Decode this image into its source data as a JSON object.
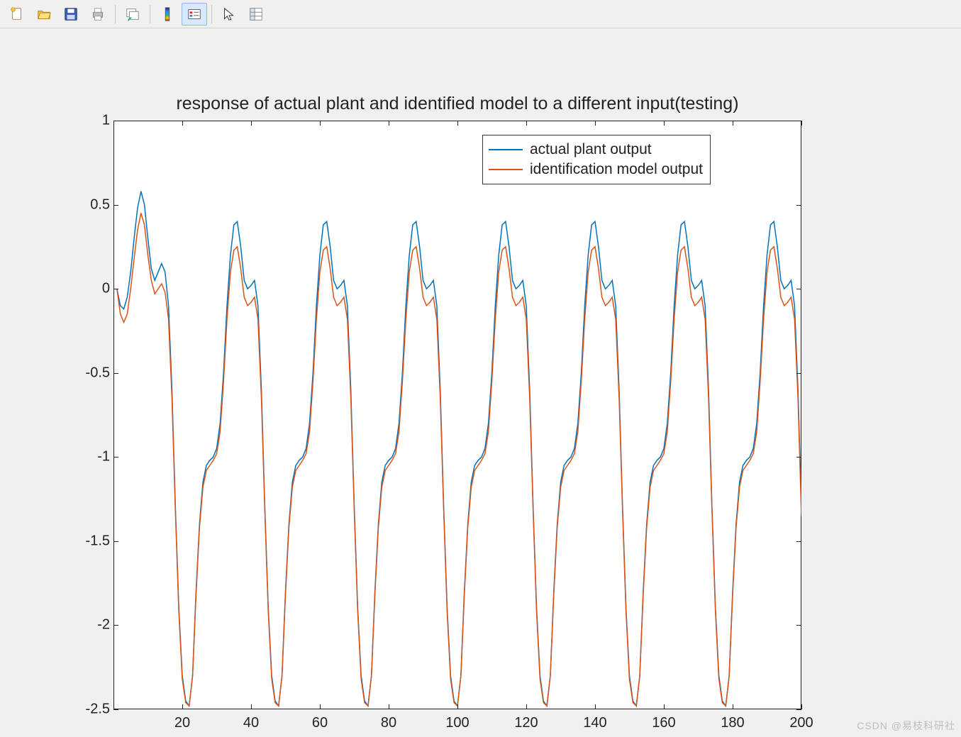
{
  "toolbar": {
    "items": [
      {
        "name": "new-icon",
        "sep": false,
        "active": false
      },
      {
        "name": "open-icon",
        "sep": false,
        "active": false
      },
      {
        "name": "save-icon",
        "sep": false,
        "active": false
      },
      {
        "name": "print-icon",
        "sep": false,
        "active": false
      },
      {
        "name": "sep"
      },
      {
        "name": "link-axes-icon",
        "sep": false,
        "active": false
      },
      {
        "name": "sep"
      },
      {
        "name": "colorbar-icon",
        "sep": false,
        "active": false
      },
      {
        "name": "legend-icon",
        "sep": false,
        "active": true
      },
      {
        "name": "sep"
      },
      {
        "name": "cursor-icon",
        "sep": false,
        "active": false
      },
      {
        "name": "properties-icon",
        "sep": false,
        "active": false
      }
    ]
  },
  "watermark": "CSDN @易枝科研社",
  "chart_data": {
    "type": "line",
    "title": "response of actual plant and identified model to a different input(testing)",
    "xlabel": "",
    "ylabel": "",
    "xlim": [
      0,
      200
    ],
    "ylim": [
      -2.5,
      1
    ],
    "xticks": [
      20,
      40,
      60,
      80,
      100,
      120,
      140,
      160,
      180,
      200
    ],
    "yticks": [
      -2.5,
      -2,
      -1.5,
      -1,
      -0.5,
      0,
      0.5,
      1
    ],
    "legend_position": "northeast",
    "series": [
      {
        "name": "actual plant output",
        "color": "#0072bd",
        "x": [
          1,
          2,
          3,
          4,
          5,
          6,
          7,
          8,
          9,
          10,
          11,
          12,
          13,
          14,
          15,
          16,
          17,
          18,
          19,
          20,
          21,
          22,
          23,
          24,
          25,
          26,
          27,
          28,
          29,
          30,
          31,
          32,
          33,
          34,
          35,
          36,
          37,
          38,
          39,
          40,
          41,
          42,
          43,
          44,
          45,
          46,
          47,
          48,
          49,
          50,
          51,
          52,
          53,
          54,
          55,
          56,
          57,
          58,
          59,
          60,
          61,
          62,
          63,
          64,
          65,
          66,
          67,
          68,
          69,
          70,
          71,
          72,
          73,
          74,
          75,
          76,
          77,
          78,
          79,
          80,
          81,
          82,
          83,
          84,
          85,
          86,
          87,
          88,
          89,
          90,
          91,
          92,
          93,
          94,
          95,
          96,
          97,
          98,
          99,
          100,
          101,
          102,
          103,
          104,
          105,
          106,
          107,
          108,
          109,
          110,
          111,
          112,
          113,
          114,
          115,
          116,
          117,
          118,
          119,
          120,
          121,
          122,
          123,
          124,
          125,
          126,
          127,
          128,
          129,
          130,
          131,
          132,
          133,
          134,
          135,
          136,
          137,
          138,
          139,
          140,
          141,
          142,
          143,
          144,
          145,
          146,
          147,
          148,
          149,
          150,
          151,
          152,
          153,
          154,
          155,
          156,
          157,
          158,
          159,
          160,
          161,
          162,
          163,
          164,
          165,
          166,
          167,
          168,
          169,
          170,
          171,
          172,
          173,
          174,
          175,
          176,
          177,
          178,
          179,
          180,
          181,
          182,
          183,
          184,
          185,
          186,
          187,
          188,
          189,
          190,
          191,
          192,
          193,
          194,
          195,
          196,
          197,
          198,
          199,
          200
        ],
        "y": [
          0.0,
          -0.1,
          -0.12,
          -0.05,
          0.1,
          0.3,
          0.48,
          0.58,
          0.5,
          0.3,
          0.12,
          0.05,
          0.1,
          0.15,
          0.1,
          -0.1,
          -0.6,
          -1.3,
          -1.9,
          -2.3,
          -2.45,
          -2.48,
          -2.3,
          -1.8,
          -1.4,
          -1.15,
          -1.05,
          -1.02,
          -1.0,
          -0.95,
          -0.8,
          -0.5,
          -0.1,
          0.2,
          0.38,
          0.4,
          0.25,
          0.05,
          0.0,
          0.02,
          0.05,
          -0.1,
          -0.6,
          -1.3,
          -1.9,
          -2.3,
          -2.45,
          -2.48,
          -2.3,
          -1.8,
          -1.4,
          -1.15,
          -1.05,
          -1.02,
          -1.0,
          -0.95,
          -0.8,
          -0.5,
          -0.1,
          0.2,
          0.38,
          0.4,
          0.25,
          0.05,
          0.0,
          0.02,
          0.05,
          -0.1,
          -0.6,
          -1.3,
          -1.9,
          -2.3,
          -2.45,
          -2.48,
          -2.3,
          -1.8,
          -1.4,
          -1.15,
          -1.05,
          -1.02,
          -1.0,
          -0.95,
          -0.8,
          -0.5,
          -0.1,
          0.2,
          0.38,
          0.4,
          0.25,
          0.05,
          0.0,
          0.02,
          0.05,
          -0.1,
          -0.6,
          -1.3,
          -1.9,
          -2.3,
          -2.45,
          -2.48,
          -2.3,
          -1.8,
          -1.4,
          -1.15,
          -1.05,
          -1.02,
          -1.0,
          -0.95,
          -0.8,
          -0.5,
          -0.1,
          0.2,
          0.38,
          0.4,
          0.25,
          0.05,
          0.0,
          0.02,
          0.05,
          -0.1,
          -0.6,
          -1.3,
          -1.9,
          -2.3,
          -2.45,
          -2.48,
          -2.3,
          -1.8,
          -1.4,
          -1.15,
          -1.05,
          -1.02,
          -1.0,
          -0.95,
          -0.8,
          -0.5,
          -0.1,
          0.2,
          0.38,
          0.4,
          0.25,
          0.05,
          0.0,
          0.02,
          0.05,
          -0.1,
          -0.6,
          -1.3,
          -1.9,
          -2.3,
          -2.45,
          -2.48,
          -2.3,
          -1.8,
          -1.4,
          -1.15,
          -1.05,
          -1.02,
          -1.0,
          -0.95,
          -0.8,
          -0.5,
          -0.1,
          0.2,
          0.38,
          0.4,
          0.25,
          0.05,
          0.0,
          0.02,
          0.05,
          -0.1,
          -0.6,
          -1.3,
          -1.9,
          -2.3,
          -2.45,
          -2.48,
          -2.3,
          -1.8,
          -1.4,
          -1.15,
          -1.05,
          -1.02,
          -1.0,
          -0.95,
          -0.8,
          -0.5,
          -0.1,
          0.2,
          0.38,
          0.4,
          0.25,
          0.05,
          0.0,
          0.02,
          0.05,
          -0.1,
          -0.6,
          -1.3
        ]
      },
      {
        "name": "identification model output",
        "color": "#d95319",
        "x": [
          1,
          2,
          3,
          4,
          5,
          6,
          7,
          8,
          9,
          10,
          11,
          12,
          13,
          14,
          15,
          16,
          17,
          18,
          19,
          20,
          21,
          22,
          23,
          24,
          25,
          26,
          27,
          28,
          29,
          30,
          31,
          32,
          33,
          34,
          35,
          36,
          37,
          38,
          39,
          40,
          41,
          42,
          43,
          44,
          45,
          46,
          47,
          48,
          49,
          50,
          51,
          52,
          53,
          54,
          55,
          56,
          57,
          58,
          59,
          60,
          61,
          62,
          63,
          64,
          65,
          66,
          67,
          68,
          69,
          70,
          71,
          72,
          73,
          74,
          75,
          76,
          77,
          78,
          79,
          80,
          81,
          82,
          83,
          84,
          85,
          86,
          87,
          88,
          89,
          90,
          91,
          92,
          93,
          94,
          95,
          96,
          97,
          98,
          99,
          100,
          101,
          102,
          103,
          104,
          105,
          106,
          107,
          108,
          109,
          110,
          111,
          112,
          113,
          114,
          115,
          116,
          117,
          118,
          119,
          120,
          121,
          122,
          123,
          124,
          125,
          126,
          127,
          128,
          129,
          130,
          131,
          132,
          133,
          134,
          135,
          136,
          137,
          138,
          139,
          140,
          141,
          142,
          143,
          144,
          145,
          146,
          147,
          148,
          149,
          150,
          151,
          152,
          153,
          154,
          155,
          156,
          157,
          158,
          159,
          160,
          161,
          162,
          163,
          164,
          165,
          166,
          167,
          168,
          169,
          170,
          171,
          172,
          173,
          174,
          175,
          176,
          177,
          178,
          179,
          180,
          181,
          182,
          183,
          184,
          185,
          186,
          187,
          188,
          189,
          190,
          191,
          192,
          193,
          194,
          195,
          196,
          197,
          198,
          199,
          200
        ],
        "y": [
          0.0,
          -0.15,
          -0.2,
          -0.15,
          0.0,
          0.18,
          0.35,
          0.45,
          0.38,
          0.2,
          0.05,
          -0.03,
          0.0,
          0.03,
          -0.02,
          -0.18,
          -0.65,
          -1.32,
          -1.92,
          -2.32,
          -2.46,
          -2.48,
          -2.3,
          -1.82,
          -1.42,
          -1.18,
          -1.08,
          -1.05,
          -1.02,
          -0.98,
          -0.85,
          -0.55,
          -0.18,
          0.1,
          0.23,
          0.25,
          0.12,
          -0.05,
          -0.1,
          -0.08,
          -0.05,
          -0.18,
          -0.65,
          -1.32,
          -1.92,
          -2.32,
          -2.46,
          -2.48,
          -2.3,
          -1.82,
          -1.42,
          -1.18,
          -1.08,
          -1.05,
          -1.02,
          -0.98,
          -0.85,
          -0.55,
          -0.18,
          0.1,
          0.23,
          0.25,
          0.12,
          -0.05,
          -0.1,
          -0.08,
          -0.05,
          -0.18,
          -0.65,
          -1.32,
          -1.92,
          -2.32,
          -2.46,
          -2.48,
          -2.3,
          -1.82,
          -1.42,
          -1.18,
          -1.08,
          -1.05,
          -1.02,
          -0.98,
          -0.85,
          -0.55,
          -0.18,
          0.1,
          0.23,
          0.25,
          0.12,
          -0.05,
          -0.1,
          -0.08,
          -0.05,
          -0.18,
          -0.65,
          -1.32,
          -1.92,
          -2.32,
          -2.46,
          -2.48,
          -2.3,
          -1.82,
          -1.42,
          -1.18,
          -1.08,
          -1.05,
          -1.02,
          -0.98,
          -0.85,
          -0.55,
          -0.18,
          0.1,
          0.23,
          0.25,
          0.12,
          -0.05,
          -0.1,
          -0.08,
          -0.05,
          -0.18,
          -0.65,
          -1.32,
          -1.92,
          -2.32,
          -2.46,
          -2.48,
          -2.3,
          -1.82,
          -1.42,
          -1.18,
          -1.08,
          -1.05,
          -1.02,
          -0.98,
          -0.85,
          -0.55,
          -0.18,
          0.1,
          0.23,
          0.25,
          0.12,
          -0.05,
          -0.1,
          -0.08,
          -0.05,
          -0.18,
          -0.65,
          -1.32,
          -1.92,
          -2.32,
          -2.46,
          -2.48,
          -2.3,
          -1.82,
          -1.42,
          -1.18,
          -1.08,
          -1.05,
          -1.02,
          -0.98,
          -0.85,
          -0.55,
          -0.18,
          0.1,
          0.23,
          0.25,
          0.12,
          -0.05,
          -0.1,
          -0.08,
          -0.05,
          -0.18,
          -0.65,
          -1.32,
          -1.92,
          -2.32,
          -2.46,
          -2.48,
          -2.3,
          -1.82,
          -1.42,
          -1.18,
          -1.08,
          -1.05,
          -1.02,
          -0.98,
          -0.85,
          -0.55,
          -0.18,
          0.1,
          0.23,
          0.25,
          0.12,
          -0.05,
          -0.1,
          -0.08,
          -0.05,
          -0.18,
          -0.65,
          -1.35
        ]
      }
    ]
  }
}
